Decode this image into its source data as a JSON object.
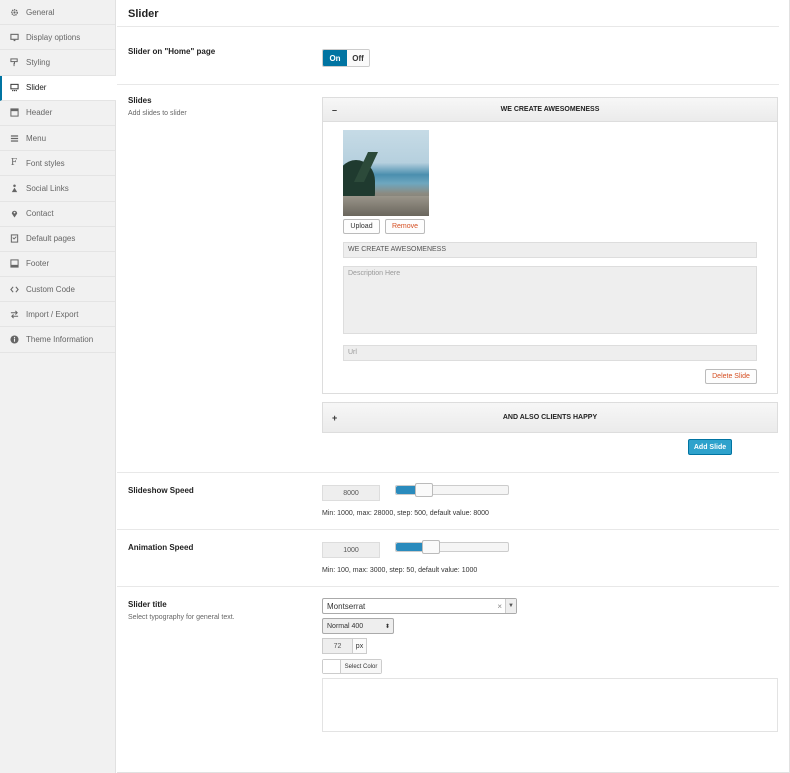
{
  "sidebar": {
    "items": [
      {
        "label": "General",
        "icon": "gear-icon"
      },
      {
        "label": "Display options",
        "icon": "monitor-icon"
      },
      {
        "label": "Styling",
        "icon": "paint-roller-icon"
      },
      {
        "label": "Slider",
        "icon": "slider-icon",
        "active": true
      },
      {
        "label": "Header",
        "icon": "header-icon"
      },
      {
        "label": "Menu",
        "icon": "menu-icon"
      },
      {
        "label": "Font styles",
        "icon": "font-icon"
      },
      {
        "label": "Social Links",
        "icon": "share-icon"
      },
      {
        "label": "Contact",
        "icon": "map-pin-icon"
      },
      {
        "label": "Default pages",
        "icon": "pages-icon"
      },
      {
        "label": "Footer",
        "icon": "footer-icon"
      },
      {
        "label": "Custom Code",
        "icon": "code-icon"
      },
      {
        "label": "Import / Export",
        "icon": "import-export-icon"
      },
      {
        "label": "Theme Information",
        "icon": "info-icon"
      }
    ]
  },
  "page": {
    "title": "Slider"
  },
  "home_slider": {
    "label": "Slider on \"Home\" page",
    "on": "On",
    "off": "Off"
  },
  "slides": {
    "label": "Slides",
    "description": "Add slides to slider",
    "slide1": {
      "toggle": "–",
      "title": "WE CREATE AWESOMENESS",
      "upload": "Upload",
      "remove": "Remove",
      "title_value": "WE CREATE AWESOMENESS",
      "description_placeholder": "Description Here",
      "url_placeholder": "Url",
      "delete": "Delete Slide"
    },
    "slide2": {
      "toggle": "+",
      "title": "AND ALSO CLIENTS HAPPY"
    },
    "add": "Add Slide"
  },
  "slideshow_speed": {
    "label": "Slideshow Speed",
    "value": "8000",
    "level": 0.25,
    "hint": "Min: 1000, max: 28000, step: 500, default value: 8000"
  },
  "animation_speed": {
    "label": "Animation Speed",
    "value": "1000",
    "level": 0.31,
    "hint": "Min: 100, max: 3000, step: 50, default value: 1000"
  },
  "slider_title": {
    "label": "Slider title",
    "description": "Select typography for general text.",
    "font": "Montserrat",
    "clear": "×",
    "weight": "Normal 400",
    "weight_arrows": "⬍",
    "size": "72",
    "unit": "px",
    "color_button": "Select Color"
  },
  "colors": {
    "accent": "#0074a2",
    "button": "#2ea2cc",
    "danger": "#d54e21"
  }
}
